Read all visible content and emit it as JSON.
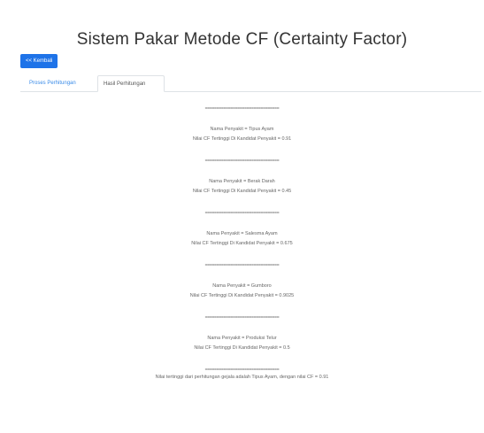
{
  "title": "Sistem Pakar Metode CF (Certainty Factor)",
  "back_button": "<< Kembali",
  "tabs": [
    {
      "label": "Proses Perhitungan",
      "active": false
    },
    {
      "label": "Hasil Perhitungan",
      "active": true
    }
  ],
  "separator": "================================",
  "results": [
    {
      "disease": "Nama Penyakit = Tipus Ayam",
      "cf": "Nilai CF Tertinggi Di Kandidat Penyakit = 0.91"
    },
    {
      "disease": "Nama Penyakit = Berak Darah",
      "cf": "Nilai CF Tertinggi Di Kandidat Penyakit = 0.45"
    },
    {
      "disease": "Nama Penyakit = Salesma Ayam",
      "cf": "Nilai CF Tertinggi Di Kandidat Penyakit = 0.675"
    },
    {
      "disease": "Nama Penyakit = Gumboro",
      "cf": "Nilai CF Tertinggi Di Kandidat Penyakit = 0.9025"
    },
    {
      "disease": "Nama Penyakit = Produksi Telur",
      "cf": "Nilai CF Tertinggi Di Kandidat Penyakit = 0.5"
    }
  ],
  "conclusion": "Nilai tertinggi dari perhitungan gejala adalah Tipus Ayam, dengan nilai CF = 0.91",
  "colors": {
    "button_bg": "#1e73e8",
    "tab_link": "#3a8be8"
  }
}
